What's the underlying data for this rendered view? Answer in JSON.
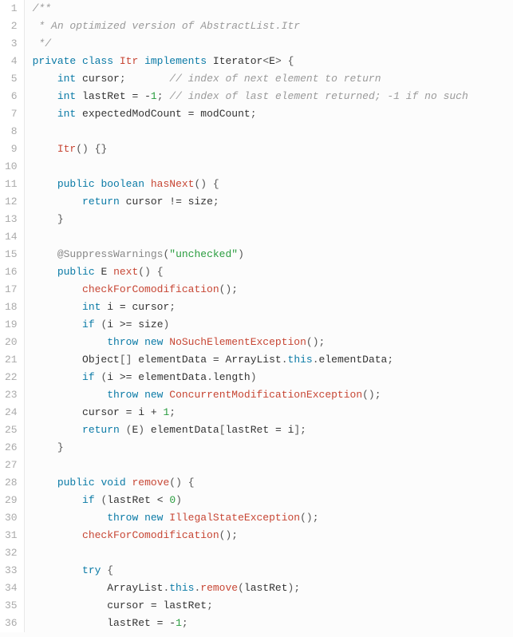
{
  "lines": [
    {
      "n": 1,
      "html": "<span class='c'>/**</span>"
    },
    {
      "n": 2,
      "html": "<span class='c'> * An optimized version of AbstractList.Itr</span>"
    },
    {
      "n": 3,
      "html": "<span class='c'> */</span>"
    },
    {
      "n": 4,
      "html": "<span class='kw'>private</span> <span class='kw'>class</span> <span class='fn'>Itr</span> <span class='kw'>implements</span> <span class='id'>Iterator</span><span class='pn'>&lt;</span><span class='id'>E</span><span class='pn'>&gt;</span> <span class='pn'>{</span>"
    },
    {
      "n": 5,
      "html": "    <span class='kw'>int</span> cursor<span class='pn'>;</span>       <span class='c'>// index of next element to return</span>"
    },
    {
      "n": 6,
      "html": "    <span class='kw'>int</span> lastRet <span class='op'>=</span> <span class='op'>-</span><span class='nu'>1</span><span class='pn'>;</span> <span class='c'>// index of last element returned; -1 if no such</span>"
    },
    {
      "n": 7,
      "html": "    <span class='kw'>int</span> expectedModCount <span class='op'>=</span> modCount<span class='pn'>;</span>"
    },
    {
      "n": 8,
      "html": ""
    },
    {
      "n": 9,
      "html": "    <span class='fn'>Itr</span><span class='pn'>()</span> <span class='pn'>{}</span>"
    },
    {
      "n": 10,
      "html": ""
    },
    {
      "n": 11,
      "html": "    <span class='kw'>public</span> <span class='kw'>boolean</span> <span class='fn'>hasNext</span><span class='pn'>()</span> <span class='pn'>{</span>"
    },
    {
      "n": 12,
      "html": "        <span class='kw'>return</span> cursor <span class='op'>!=</span> size<span class='pn'>;</span>"
    },
    {
      "n": 13,
      "html": "    <span class='pn'>}</span>"
    },
    {
      "n": 14,
      "html": ""
    },
    {
      "n": 15,
      "html": "    <span class='an'>@SuppressWarnings</span><span class='pn'>(</span><span class='st'>\"unchecked\"</span><span class='pn'>)</span>"
    },
    {
      "n": 16,
      "html": "    <span class='kw'>public</span> <span class='id'>E</span> <span class='fn'>next</span><span class='pn'>()</span> <span class='pn'>{</span>"
    },
    {
      "n": 17,
      "html": "        <span class='fn'>checkForComodification</span><span class='pn'>();</span>"
    },
    {
      "n": 18,
      "html": "        <span class='kw'>int</span> i <span class='op'>=</span> cursor<span class='pn'>;</span>"
    },
    {
      "n": 19,
      "html": "        <span class='kw'>if</span> <span class='pn'>(</span>i <span class='op'>&gt;=</span> size<span class='pn'>)</span>"
    },
    {
      "n": 20,
      "html": "            <span class='kw'>throw</span> <span class='kw'>new</span> <span class='fn'>NoSuchElementException</span><span class='pn'>();</span>"
    },
    {
      "n": 21,
      "html": "        <span class='id'>Object</span><span class='pn'>[]</span> elementData <span class='op'>=</span> ArrayList<span class='pn'>.</span><span class='kw'>this</span><span class='pn'>.</span>elementData<span class='pn'>;</span>"
    },
    {
      "n": 22,
      "html": "        <span class='kw'>if</span> <span class='pn'>(</span>i <span class='op'>&gt;=</span> elementData<span class='pn'>.</span>length<span class='pn'>)</span>"
    },
    {
      "n": 23,
      "html": "            <span class='kw'>throw</span> <span class='kw'>new</span> <span class='fn'>ConcurrentModificationException</span><span class='pn'>();</span>"
    },
    {
      "n": 24,
      "html": "        cursor <span class='op'>=</span> i <span class='op'>+</span> <span class='nu'>1</span><span class='pn'>;</span>"
    },
    {
      "n": 25,
      "html": "        <span class='kw'>return</span> <span class='pn'>(</span><span class='id'>E</span><span class='pn'>)</span> elementData<span class='pn'>[</span>lastRet <span class='op'>=</span> i<span class='pn'>];</span>"
    },
    {
      "n": 26,
      "html": "    <span class='pn'>}</span>"
    },
    {
      "n": 27,
      "html": ""
    },
    {
      "n": 28,
      "html": "    <span class='kw'>public</span> <span class='kw'>void</span> <span class='fn'>remove</span><span class='pn'>()</span> <span class='pn'>{</span>"
    },
    {
      "n": 29,
      "html": "        <span class='kw'>if</span> <span class='pn'>(</span>lastRet <span class='op'>&lt;</span> <span class='nu'>0</span><span class='pn'>)</span>"
    },
    {
      "n": 30,
      "html": "            <span class='kw'>throw</span> <span class='kw'>new</span> <span class='fn'>IllegalStateException</span><span class='pn'>();</span>"
    },
    {
      "n": 31,
      "html": "        <span class='fn'>checkForComodification</span><span class='pn'>();</span>"
    },
    {
      "n": 32,
      "html": ""
    },
    {
      "n": 33,
      "html": "        <span class='kw'>try</span> <span class='pn'>{</span>"
    },
    {
      "n": 34,
      "html": "            ArrayList<span class='pn'>.</span><span class='kw'>this</span><span class='pn'>.</span><span class='fn'>remove</span><span class='pn'>(</span>lastRet<span class='pn'>);</span>"
    },
    {
      "n": 35,
      "html": "            cursor <span class='op'>=</span> lastRet<span class='pn'>;</span>"
    },
    {
      "n": 36,
      "html": "            lastRet <span class='op'>=</span> <span class='op'>-</span><span class='nu'>1</span><span class='pn'>;</span>"
    }
  ]
}
